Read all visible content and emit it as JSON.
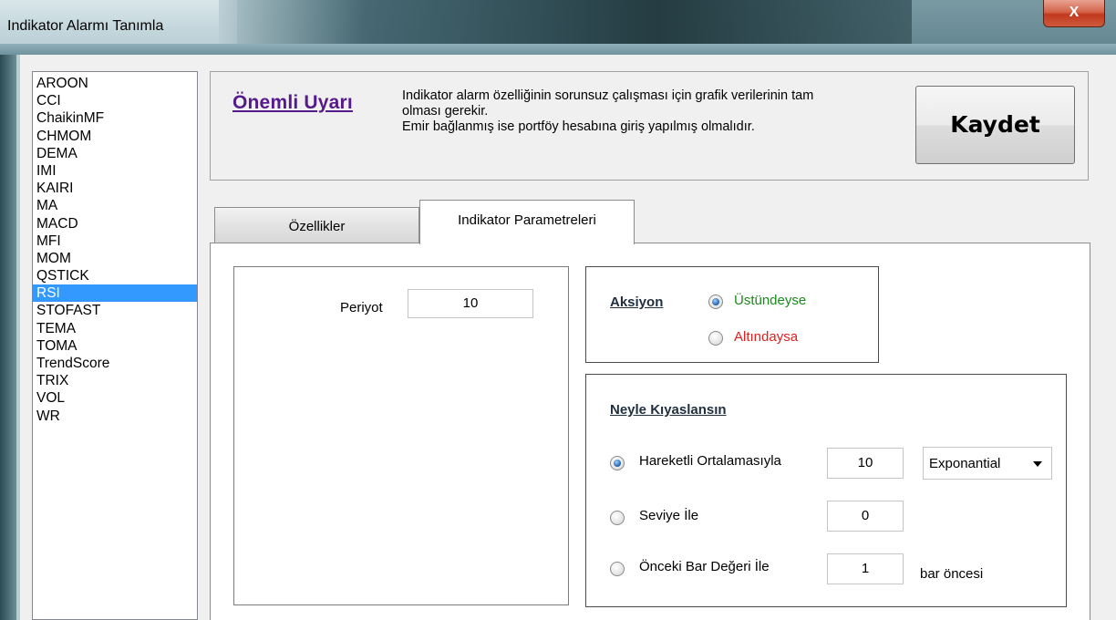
{
  "window": {
    "title": "Indikator Alarmı Tanımla",
    "close_label": "X"
  },
  "indicators": {
    "items": [
      "AROON",
      "CCI",
      "ChaikinMF",
      "CHMOM",
      "DEMA",
      "IMI",
      "KAIRI",
      "MA",
      "MACD",
      "MFI",
      "MOM",
      "QSTICK",
      "RSI",
      "STOFAST",
      "TEMA",
      "TOMA",
      "TrendScore",
      "TRIX",
      "VOL",
      "WR"
    ],
    "selected": "RSI"
  },
  "warning": {
    "title": "Önemli Uyarı",
    "lines": [
      "Indikator alarm özelliğinin sorunsuz çalışması için grafik verilerinin tam",
      "olması gerekir.",
      "Emir bağlanmış ise portföy hesabına giriş yapılmış olmalıdır."
    ],
    "save_label": "Kaydet"
  },
  "tabs": {
    "features_label": "Özellikler",
    "params_label": "Indikator Parametreleri"
  },
  "params": {
    "period_label": "Periyot",
    "period_value": "10"
  },
  "action": {
    "title": "Aksiyon",
    "above_label": "Üstündeyse",
    "below_label": "Altındaysa",
    "above_color": "#1a8a1a",
    "below_color": "#e02020",
    "selected": "above"
  },
  "compare": {
    "title": "Neyle Kıyaslansın",
    "ma_label": "Hareketli Ortalamasıyla",
    "ma_value": "10",
    "ma_type": "Exponantial",
    "level_label": "Seviye İle",
    "level_value": "0",
    "prev_bar_label": "Önceki Bar Değeri İle",
    "prev_bar_value": "1",
    "prev_bar_suffix": "bar öncesi",
    "selected": "ma"
  }
}
